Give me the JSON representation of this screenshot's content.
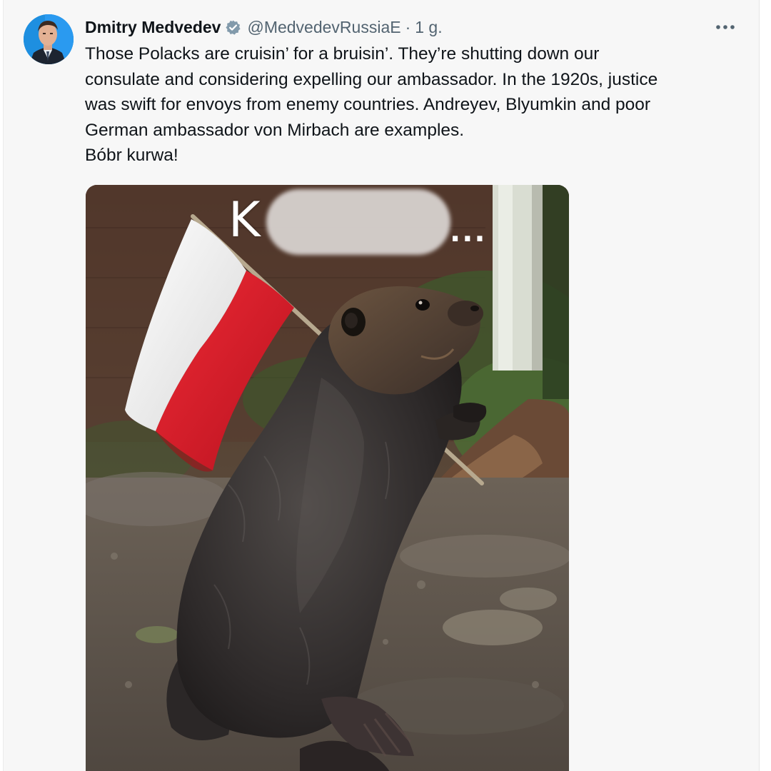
{
  "tweet": {
    "author_name": "Dmitry Medvedev",
    "handle": "@MedvedevRussiaE",
    "separator": "·",
    "time": "1 g.",
    "more_icon": "ellipsis-horizontal-icon",
    "verified_icon": "verified-badge-icon",
    "text": "Those Polacks are cruisin’ for a bruisin’. They’re shutting down our\nconsulate and considering expelling our ambassador. In the 1920s, justice\nwas swift for envoys from enemy countries. Andreyev, Blyumkin and poor\nGerman ambassador von Mirbach are examples.\nBóbr kurwa!"
  },
  "media": {
    "caption_visible_letter": "K",
    "caption_ellipsis": "...",
    "caption_blurred": true
  },
  "colors": {
    "text_primary": "#0f1419",
    "text_secondary": "#536471",
    "verified_badge": "#829aab",
    "flag_white": "#f2f2f2",
    "flag_red": "#dc1f2e"
  }
}
